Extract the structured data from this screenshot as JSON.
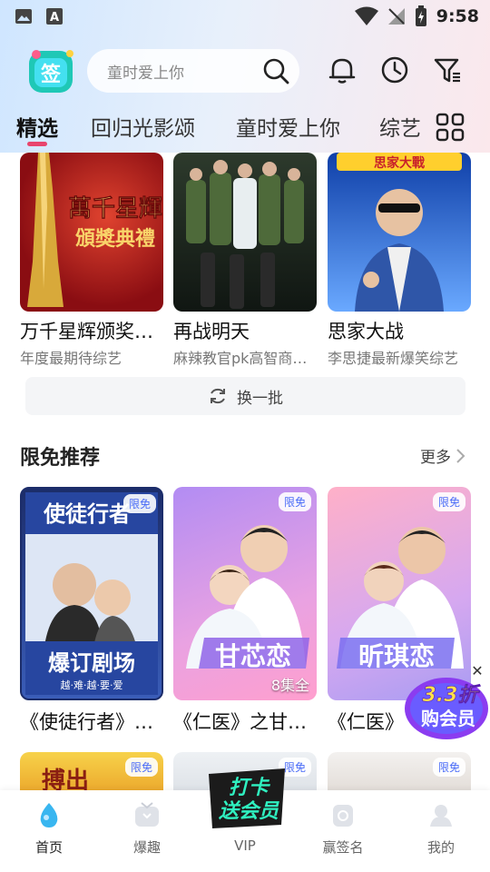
{
  "status_bar": {
    "time": "9:58"
  },
  "header": {
    "logo_text": "签",
    "search_placeholder": "童时爱上你",
    "icons": [
      "bell-icon",
      "history-clock-icon",
      "filter-icon"
    ]
  },
  "tabs": [
    {
      "label": "精选",
      "active": true
    },
    {
      "label": "回归光影颂",
      "active": false
    },
    {
      "label": "童时爱上你",
      "active": false
    },
    {
      "label": "综艺",
      "active": false
    }
  ],
  "top_cards": [
    {
      "title": "万千星辉颁奖…",
      "subtitle": "年度最期待综艺",
      "poster_text": "萬千星輝\n頒獎典禮",
      "colors": [
        "#8a0d12",
        "#d23a2a"
      ]
    },
    {
      "title": "再战明天",
      "subtitle": "麻辣教官pk高智商…",
      "poster_text": "",
      "colors": [
        "#1c2a1e",
        "#4b5d3f"
      ]
    },
    {
      "title": "思家大战",
      "subtitle": "李思捷最新爆笑综艺",
      "poster_text": "思家大戰",
      "colors": [
        "#1e57c9",
        "#7ab4ff"
      ]
    }
  ],
  "refresh": {
    "label": "换一批"
  },
  "free_section": {
    "title": "限免推荐",
    "more_label": "更多",
    "cards": [
      {
        "title": "《使徒行者》…",
        "badge": "限免",
        "poster_top": "使徒行者",
        "poster_bottom": "爆订剧场",
        "poster_caption": "越·难·越·要·爱",
        "episodes": "",
        "colors": [
          "#1c2d6a",
          "#3a5db8"
        ]
      },
      {
        "title": "《仁医》之甘…",
        "badge": "限免",
        "poster_top": "",
        "poster_bottom": "甘芯恋",
        "poster_caption": "",
        "episodes": "8集全",
        "colors": [
          "#c99af0",
          "#ff9fce"
        ]
      },
      {
        "title": "《仁医》",
        "badge": "限免",
        "poster_top": "",
        "poster_bottom": "昕琪恋",
        "poster_caption": "",
        "episodes": "",
        "colors": [
          "#f7a7c7",
          "#b5a1f2"
        ]
      }
    ],
    "row2_badges": [
      "限免",
      "限免",
      "限免"
    ],
    "row2_poster_text": "搏出"
  },
  "promo": {
    "line1": "3.3折",
    "line2": "购会员"
  },
  "vip_badge": {
    "line1": "打卡",
    "line2": "送会员"
  },
  "bottom_nav": [
    {
      "label": "首页",
      "icon": "home-drop-icon",
      "active": true
    },
    {
      "label": "爆趣",
      "icon": "tv-icon",
      "active": false
    },
    {
      "label": "VIP",
      "icon": "vip-icon",
      "active": false
    },
    {
      "label": "赢签名",
      "icon": "signature-cup-icon",
      "active": false
    },
    {
      "label": "我的",
      "icon": "profile-icon",
      "active": false
    }
  ]
}
